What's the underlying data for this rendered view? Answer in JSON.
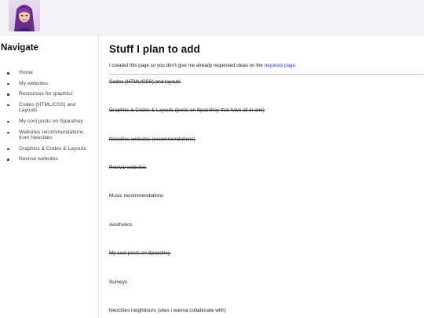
{
  "sidebar": {
    "title": "Navigate",
    "items": [
      "Home",
      "My websites",
      "Resources for graphics",
      "Codes (HTML/CSS) and Layouts",
      "My cool posts on Spacehey",
      "Websites recommendations from Neocities",
      "Graphics & Codes & Layouts",
      "Revival websites"
    ]
  },
  "main": {
    "title": "Stuff I plan to add",
    "intro_prefix": "I created this page so you don't give me already requested ideas on the ",
    "intro_link": "requests page",
    "intro_suffix": ".",
    "items": [
      {
        "text": "Codes (HTML/CSS) and layouts",
        "done": true
      },
      {
        "text": "Graphics & Codes & Layouts (posts on Spacehey that have all in one)",
        "done": true
      },
      {
        "text": "Neocities websites (recommendations)",
        "done": true
      },
      {
        "text": "Revival websites",
        "done": true
      },
      {
        "text": "Music recommendations",
        "done": false
      },
      {
        "text": "Aesthetics",
        "done": false
      },
      {
        "text": "My cool posts on Spacehey",
        "done": true
      },
      {
        "text": "Surveys",
        "done": false
      },
      {
        "text": "Neocities neighbours (sites i wanna collaborate with)",
        "done": false
      }
    ]
  },
  "colors": {
    "link": "#2a3fd6",
    "topbar": "#f4f4f8"
  }
}
